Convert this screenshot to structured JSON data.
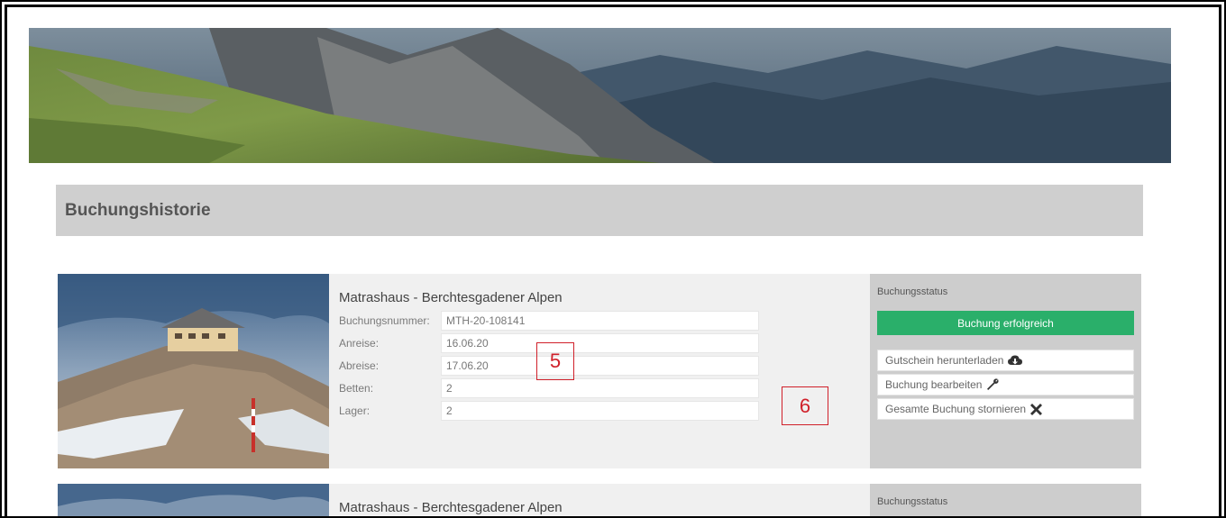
{
  "page": {
    "section_title": "Buchungshistorie"
  },
  "bookings": [
    {
      "hut_name": "Matrashaus - Berchtesgadener Alpen",
      "fields": [
        {
          "label": "Buchungsnummer:",
          "value": "MTH-20-108141"
        },
        {
          "label": "Anreise:",
          "value": "16.06.20"
        },
        {
          "label": "Abreise:",
          "value": "17.06.20"
        },
        {
          "label": "Betten:",
          "value": "2"
        },
        {
          "label": "Lager:",
          "value": "2"
        }
      ],
      "status_title": "Buchungsstatus",
      "status_value": "Buchung erfolgreich",
      "actions": [
        {
          "label": "Gutschein herunterladen",
          "icon": "cloud-download-icon"
        },
        {
          "label": "Buchung bearbeiten",
          "icon": "wrench-icon"
        },
        {
          "label": "Gesamte Buchung stornieren",
          "icon": "close-icon"
        }
      ]
    },
    {
      "hut_name": "Matrashaus - Berchtesgadener Alpen",
      "status_title": "Buchungsstatus"
    }
  ],
  "annotations": [
    "5",
    "6"
  ],
  "colors": {
    "success": "#2aaf6a",
    "header_bg": "#cfcfcf",
    "status_bg": "#cdcdcd",
    "card_bg": "#f0f0f0",
    "annotation": "#d0202a"
  }
}
